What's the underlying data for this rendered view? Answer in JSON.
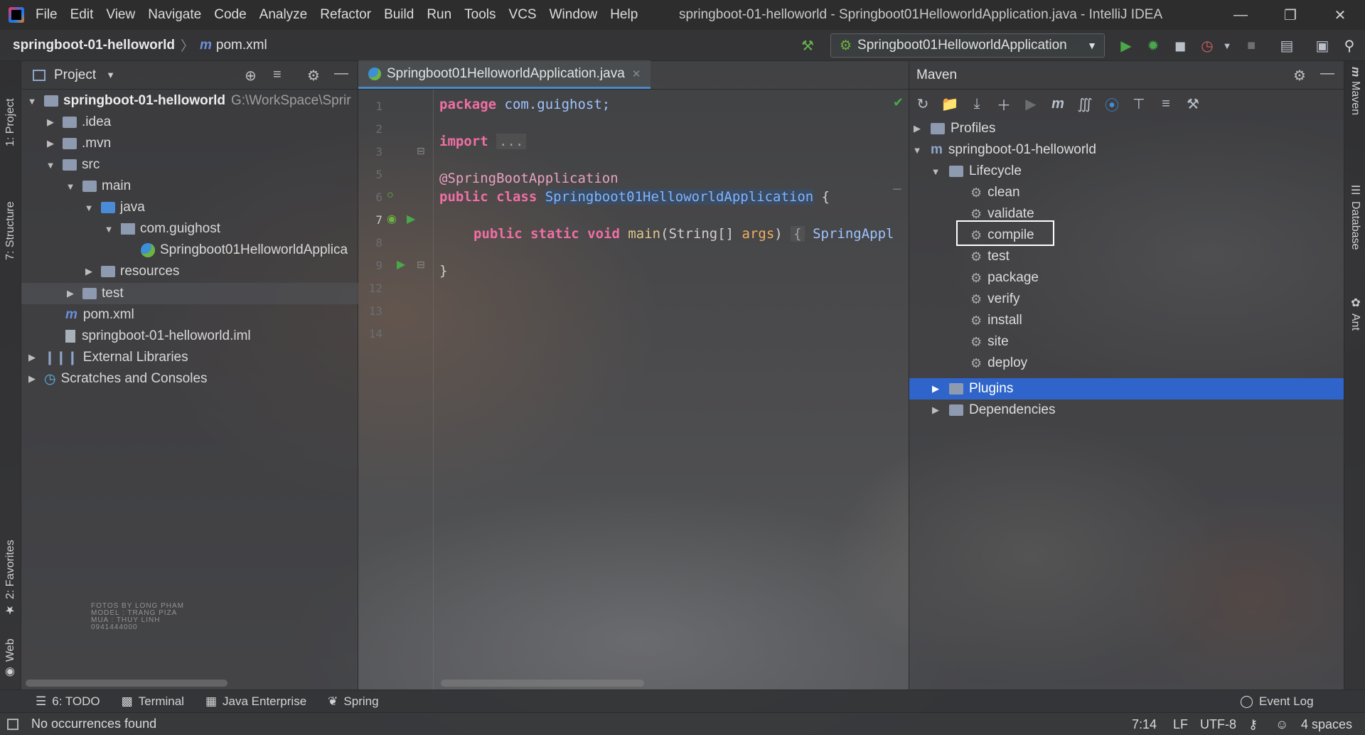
{
  "menubar": {
    "items": [
      "File",
      "Edit",
      "View",
      "Navigate",
      "Code",
      "Analyze",
      "Refactor",
      "Build",
      "Run",
      "Tools",
      "VCS",
      "Window",
      "Help"
    ],
    "window_title": "springboot-01-helloworld - Springboot01HelloworldApplication.java - IntelliJ IDEA"
  },
  "navbar": {
    "project": "springboot-01-helloworld",
    "file_icon_letter": "m",
    "file": "pom.xml",
    "run_config": "Springboot01HelloworldApplication"
  },
  "left_strip": {
    "project_tab": "1: Project",
    "structure_tab": "7: Structure",
    "favorites_tab": "2: Favorites",
    "web_tab": "Web"
  },
  "project_panel": {
    "title": "Project",
    "tree": [
      {
        "label": "springboot-01-helloworld",
        "path": "G:\\WorkSpace\\Sprir"
      },
      {
        "label": ".idea"
      },
      {
        "label": ".mvn"
      },
      {
        "label": "src"
      },
      {
        "label": "main"
      },
      {
        "label": "java"
      },
      {
        "label": "com.guighost"
      },
      {
        "label": "Springboot01HelloworldApplica"
      },
      {
        "label": "resources"
      },
      {
        "label": "test"
      },
      {
        "label": "pom.xml"
      },
      {
        "label": "springboot-01-helloworld.iml"
      },
      {
        "label": "External Libraries"
      },
      {
        "label": "Scratches and Consoles"
      }
    ]
  },
  "editor": {
    "tab_label": "Springboot01HelloworldApplication.java",
    "line_numbers": [
      "1",
      "2",
      "3",
      "5",
      "6",
      "7",
      "8",
      "9",
      "12",
      "13",
      "14"
    ],
    "code": {
      "l1_kw": "package",
      "l1_rest": " com.guighost;",
      "l3_kw": "import",
      "l3_fold": "...",
      "l6_ann": "@SpringBootApplication",
      "l7_kw": "public class",
      "l7_cls": "Springboot01HelloworldApplication",
      "l7_rest": " {",
      "l9_kw": "public static void",
      "l9_fn": "main",
      "l9_p1": "(String[] ",
      "l9_param": "args",
      "l9_p2": ") ",
      "l9_fold": "{",
      "l9_tail": " SpringAppl",
      "l13": "}"
    }
  },
  "maven": {
    "title": "Maven",
    "tree": {
      "profiles": "Profiles",
      "project": "springboot-01-helloworld",
      "lifecycle": "Lifecycle",
      "goals": [
        "clean",
        "validate",
        "compile",
        "test",
        "package",
        "verify",
        "install",
        "site",
        "deploy"
      ],
      "plugins": "Plugins",
      "dependencies": "Dependencies"
    },
    "selected_item": "Plugins",
    "highlighted_goal": "package"
  },
  "right_strip": {
    "maven_tab": "Maven",
    "database_tab": "Database",
    "ant_tab": "Ant"
  },
  "tool_windows": {
    "todo": "6: TODO",
    "terminal": "Terminal",
    "java_enterprise": "Java Enterprise",
    "spring": "Spring",
    "event_log": "Event Log"
  },
  "status": {
    "message": "No occurrences found",
    "position": "7:14",
    "line_sep": "LF",
    "encoding": "UTF-8",
    "indent": "4 spaces"
  },
  "watermark": [
    "FOTOS BY LONG PHAM",
    "MODEL : TRANG PIZA",
    "MUA : THUY LINH",
    "0941444000"
  ],
  "colors": {
    "selection": "#2f65ca",
    "keyword": "#f06fa4",
    "run_green": "#49a84a",
    "tab_underline": "#4a88c7"
  }
}
